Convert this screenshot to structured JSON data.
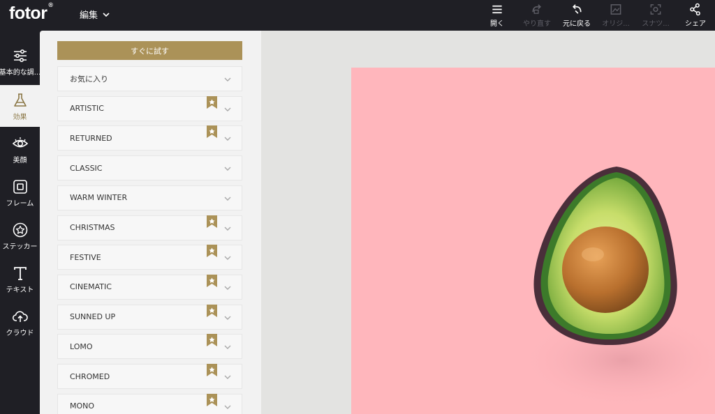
{
  "app": {
    "logo": "fotor",
    "logo_mark": "®",
    "edit_menu": "編集"
  },
  "toolbar": {
    "open": "開く",
    "redo": "やり直す",
    "undo": "元に戻る",
    "original": "オリジ...",
    "snapshot": "スナツ...",
    "share": "シェア"
  },
  "rail": {
    "items": [
      {
        "label": "基本的な調..."
      },
      {
        "label": "効果"
      },
      {
        "label": "美顔"
      },
      {
        "label": "フレーム"
      },
      {
        "label": "ステッカー"
      },
      {
        "label": "テキスト"
      },
      {
        "label": "クラウド"
      }
    ]
  },
  "panel": {
    "try_now": "すぐに試す",
    "categories": [
      {
        "label": "お気に入り",
        "badge": false
      },
      {
        "label": "ARTISTIC",
        "badge": true
      },
      {
        "label": "RETURNED",
        "badge": true
      },
      {
        "label": "CLASSIC",
        "badge": false
      },
      {
        "label": "WARM WINTER",
        "badge": false
      },
      {
        "label": "CHRISTMAS",
        "badge": true
      },
      {
        "label": "FESTIVE",
        "badge": true
      },
      {
        "label": "CINEMATIC",
        "badge": true
      },
      {
        "label": "SUNNED UP",
        "badge": true
      },
      {
        "label": "LOMO",
        "badge": true
      },
      {
        "label": "CHROMED",
        "badge": true
      },
      {
        "label": "MONO",
        "badge": true
      }
    ]
  },
  "colors": {
    "accent": "#ab9258",
    "dark": "#1f1f25",
    "panel": "#f2f2f2",
    "photo_bg": "#ffb6bc"
  }
}
